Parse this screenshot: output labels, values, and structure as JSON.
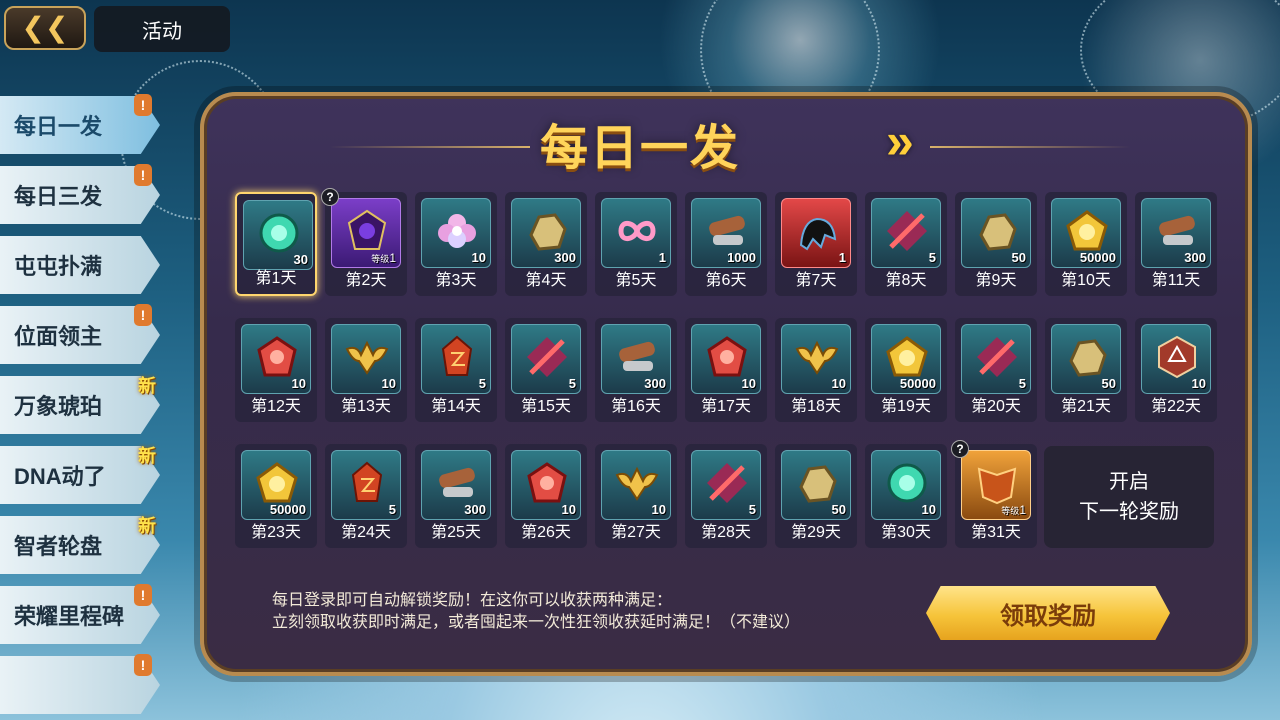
{
  "header": {
    "back_icon": "back-arrow-icon",
    "title": "活动"
  },
  "sidebar": {
    "items": [
      {
        "label": "每日一发",
        "badge": "!",
        "active": true
      },
      {
        "label": "每日三发",
        "badge": "!"
      },
      {
        "label": "屯屯扑满",
        "badge": ""
      },
      {
        "label": "位面领主",
        "badge": "!"
      },
      {
        "label": "万象琥珀",
        "badge": "新"
      },
      {
        "label": "DNA动了",
        "badge": "新"
      },
      {
        "label": "智者轮盘",
        "badge": "新"
      },
      {
        "label": "荣耀里程碑",
        "badge": "!"
      },
      {
        "label": "",
        "badge": "!"
      }
    ]
  },
  "panel": {
    "title": "每日一发",
    "arrow_icon": "double-chevron-right-icon",
    "rewards": [
      {
        "day": "第1天",
        "qty": "30",
        "icon": "green-gem-icon",
        "theme": "teal",
        "selected": true
      },
      {
        "day": "第2天",
        "qty": "1",
        "level_label": "等级",
        "icon": "purple-crest-icon",
        "theme": "purple",
        "question": "?"
      },
      {
        "day": "第3天",
        "qty": "10",
        "icon": "pink-flower-icon",
        "theme": "teal"
      },
      {
        "day": "第4天",
        "qty": "300",
        "icon": "gold-ore-icon",
        "theme": "teal"
      },
      {
        "day": "第5天",
        "qty": "1",
        "icon": "pink-infinity-icon",
        "theme": "teal"
      },
      {
        "day": "第6天",
        "qty": "1000",
        "icon": "wood-log-icon",
        "theme": "teal"
      },
      {
        "day": "第7天",
        "qty": "1",
        "icon": "dark-creature-icon",
        "theme": "red"
      },
      {
        "day": "第8天",
        "qty": "5",
        "icon": "red-slash-icon",
        "theme": "teal"
      },
      {
        "day": "第9天",
        "qty": "50",
        "icon": "gold-ore-icon",
        "theme": "teal"
      },
      {
        "day": "第10天",
        "qty": "50000",
        "icon": "gold-coin-icon",
        "theme": "teal"
      },
      {
        "day": "第11天",
        "qty": "300",
        "icon": "wood-log-icon",
        "theme": "teal"
      },
      {
        "day": "第12天",
        "qty": "10",
        "icon": "red-gem-icon",
        "theme": "teal"
      },
      {
        "day": "第13天",
        "qty": "10",
        "icon": "winged-star-icon",
        "theme": "teal"
      },
      {
        "day": "第14天",
        "qty": "5",
        "icon": "red-crystal-icon",
        "theme": "teal"
      },
      {
        "day": "第15天",
        "qty": "5",
        "icon": "red-slash-icon",
        "theme": "teal"
      },
      {
        "day": "第16天",
        "qty": "300",
        "icon": "wood-log-icon",
        "theme": "teal"
      },
      {
        "day": "第17天",
        "qty": "10",
        "icon": "red-gem-icon",
        "theme": "teal"
      },
      {
        "day": "第18天",
        "qty": "10",
        "icon": "winged-star-icon",
        "theme": "teal"
      },
      {
        "day": "第19天",
        "qty": "50000",
        "icon": "gold-coin-icon",
        "theme": "teal"
      },
      {
        "day": "第20天",
        "qty": "5",
        "icon": "red-slash-icon",
        "theme": "teal"
      },
      {
        "day": "第21天",
        "qty": "50",
        "icon": "gold-ore-icon",
        "theme": "teal"
      },
      {
        "day": "第22天",
        "qty": "10",
        "icon": "hexagon-emblem-icon",
        "theme": "teal"
      },
      {
        "day": "第23天",
        "qty": "50000",
        "icon": "gold-coin-icon",
        "theme": "teal"
      },
      {
        "day": "第24天",
        "qty": "5",
        "icon": "red-crystal-icon",
        "theme": "teal"
      },
      {
        "day": "第25天",
        "qty": "300",
        "icon": "wood-log-icon",
        "theme": "teal"
      },
      {
        "day": "第26天",
        "qty": "10",
        "icon": "red-gem-icon",
        "theme": "teal"
      },
      {
        "day": "第27天",
        "qty": "10",
        "icon": "winged-star-icon",
        "theme": "teal"
      },
      {
        "day": "第28天",
        "qty": "5",
        "icon": "red-slash-icon",
        "theme": "teal"
      },
      {
        "day": "第29天",
        "qty": "50",
        "icon": "gold-ore-icon",
        "theme": "teal"
      },
      {
        "day": "第30天",
        "qty": "10",
        "icon": "green-gem-icon",
        "theme": "teal"
      },
      {
        "day": "第31天",
        "qty": "1",
        "level_label": "等级",
        "icon": "orange-crest-icon",
        "theme": "gold",
        "question": "?"
      }
    ],
    "next_round": {
      "line1": "开启",
      "line2": "下一轮奖励"
    },
    "description": {
      "line1": "每日登录即可自动解锁奖励！在这你可以收获两种满足：",
      "line2": "立刻领取收获即时满足，或者囤起来一次性狂领收获延时满足！（不建议）"
    },
    "claim_button": "领取奖励"
  },
  "colors": {
    "accent_gold": "#ffd45a",
    "panel_bg": "#3f335b",
    "border": "#b88b4f"
  }
}
